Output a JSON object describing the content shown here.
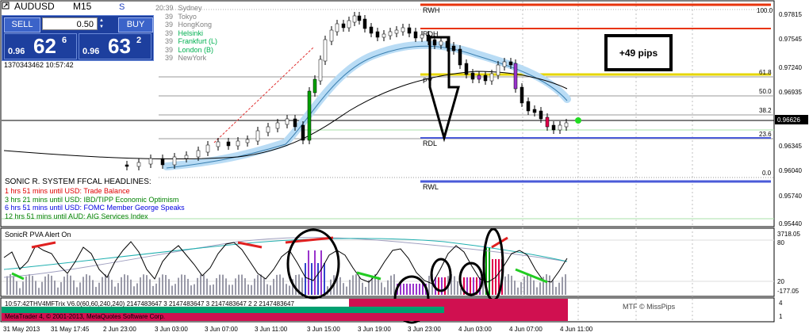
{
  "symbol": "AUDUSD",
  "timeframe": "M15",
  "trade_panel": {
    "sell_label": "SELL",
    "buy_label": "BUY",
    "lot": "0.50",
    "sell_prefix": "0.96",
    "sell_big": "62",
    "sell_sup": "6",
    "buy_prefix": "0.96",
    "buy_big": "63",
    "buy_sup": "2"
  },
  "timestamp": "1370343462 10:57:42",
  "sessions": [
    {
      "time": "20:39",
      "name": "Sydney",
      "color": "#808080"
    },
    {
      "time": "39",
      "name": "Tokyo",
      "color": "#808080"
    },
    {
      "time": "39",
      "name": "HongKong",
      "color": "#808080"
    },
    {
      "time": "39",
      "name": "Helsinki",
      "color": "#00b050"
    },
    {
      "time": "39",
      "name": "Frankfurt (L)",
      "color": "#00b050"
    },
    {
      "time": "39",
      "name": "London (B)",
      "color": "#00b050"
    },
    {
      "time": "39",
      "name": "NewYork",
      "color": "#808080"
    }
  ],
  "headlines": {
    "title": "SONIC R. SYSTEM  FFCAL HEADLINES:",
    "items": [
      {
        "text": "1 hrs 51 mins until USD: Trade Balance",
        "color": "#e00000"
      },
      {
        "text": "3 hrs 21 mins until USD: IBD/TIPP Economic Optimism",
        "color": "#008000"
      },
      {
        "text": "6 hrs 51 mins until USD: FOMC Member George Speaks",
        "color": "#0000e0"
      },
      {
        "text": "12 hrs 51 mins until AUD: AIG Services Index",
        "color": "#008000"
      }
    ]
  },
  "levels": {
    "rwh": "RWH",
    "rdh": "RDH",
    "pv": "PV",
    "rdl": "RDL",
    "rwl": "RWL"
  },
  "fib": [
    "100.0",
    "61.8",
    "50.0",
    "38.2",
    "23.6",
    "0.0"
  ],
  "annotation": "+49 pips",
  "price_axis": [
    "0.97815",
    "0.97545",
    "0.97240",
    "0.96935",
    "0.96626",
    "0.96345",
    "0.96040",
    "0.95740",
    "0.95440"
  ],
  "current_price": "0.96626",
  "indicator": {
    "title": "SonicR PVA   Alert On",
    "axis": [
      "3718.05",
      "80",
      "20",
      "-177.05"
    ]
  },
  "bottom": {
    "line1": "10:57:42THV4MFTrix V6.0(60,60,240,240) 2147483647 3 2147483647 3 2147483647 2 2 2147483647",
    "line2": "MetaTrader 4, © 2001-2013, MetaQuotes Software Corp.",
    "credit": "MTF © MissPips",
    "axis": [
      "4",
      "1"
    ]
  },
  "time_axis": [
    "31 May 2013",
    "31 May 17:45",
    "2 Jun 23:00",
    "3 Jun 03:00",
    "3 Jun 07:00",
    "3 Jun 11:00",
    "3 Jun 15:00",
    "3 Jun 19:00",
    "3 Jun 23:00",
    "4 Jun 03:00",
    "4 Jun 07:00",
    "4 Jun 11:00"
  ],
  "colors": {
    "rwh": "#e8340c",
    "rdh": "#e8340c",
    "pv": "#e6d600",
    "rdl": "#4a5ad8",
    "rwl": "#4a5ad8",
    "band": "#b9dcf5",
    "bull": "#00a000",
    "bear": "#e0004b"
  }
}
